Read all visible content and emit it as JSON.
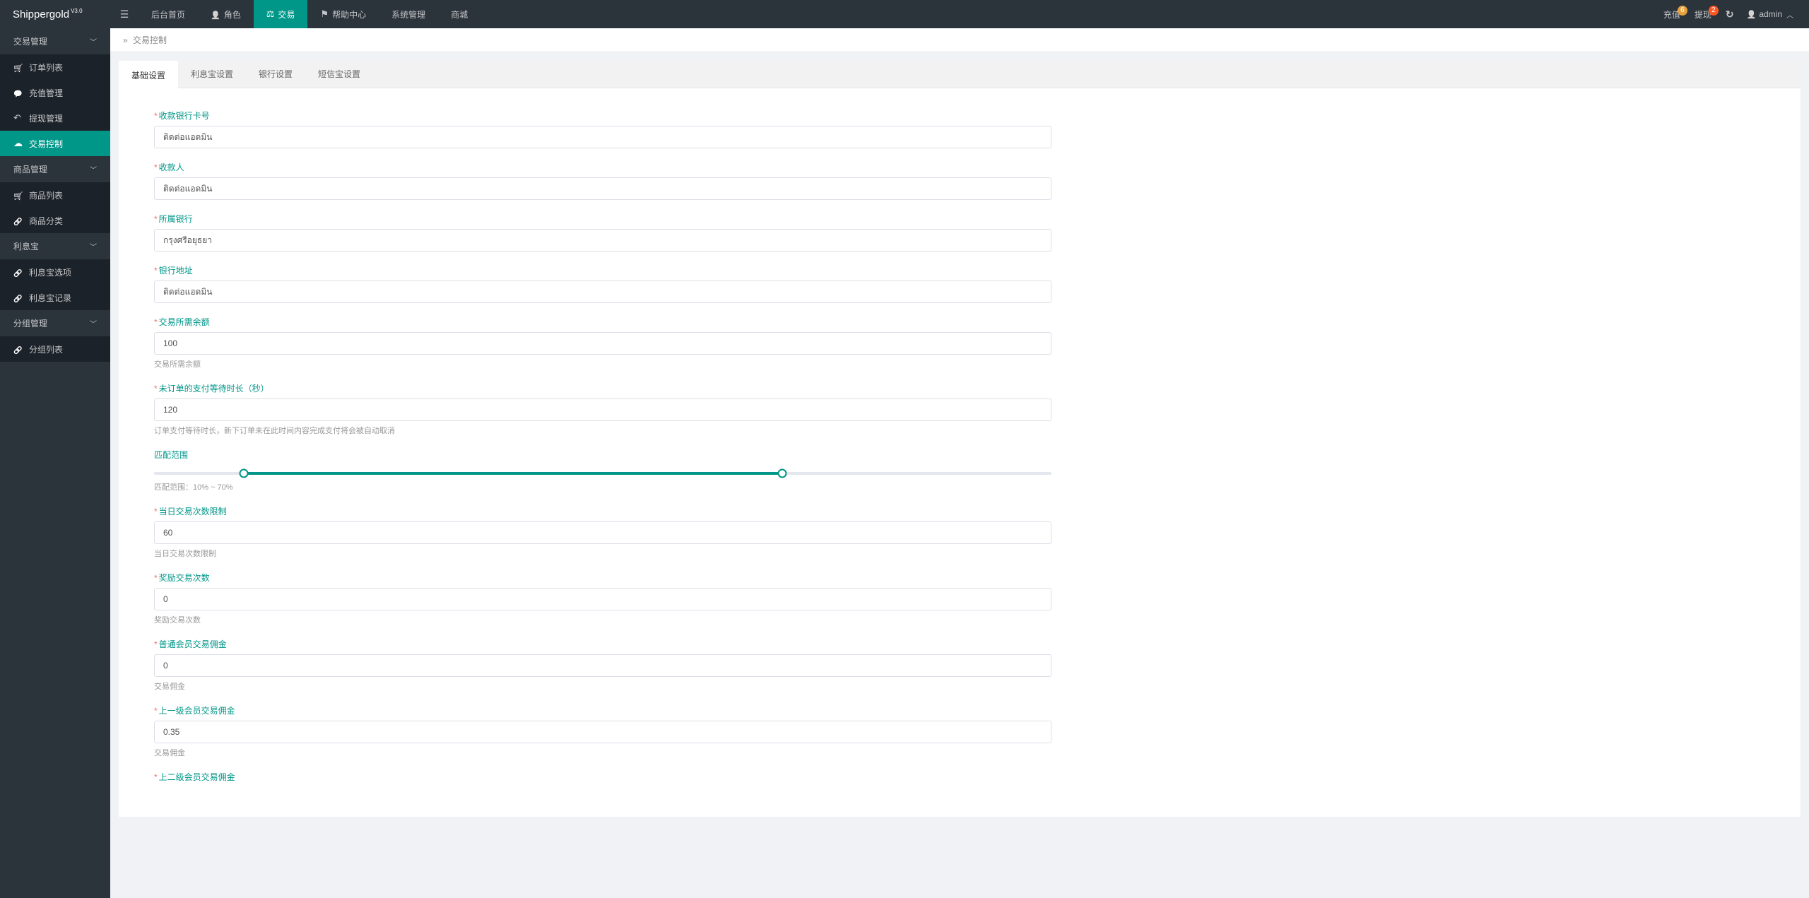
{
  "brand": {
    "name": "Shippergold",
    "version": "V3.0"
  },
  "topnav": {
    "items": [
      {
        "label": "后台首页",
        "icon": ""
      },
      {
        "label": "角色",
        "icon": "i-user"
      },
      {
        "label": "交易",
        "icon": "i-scale",
        "active": true
      },
      {
        "label": "帮助中心",
        "icon": "i-flag"
      },
      {
        "label": "系统管理",
        "icon": ""
      },
      {
        "label": "商城",
        "icon": ""
      }
    ],
    "right": {
      "recharge": {
        "label": "充值",
        "badge": "6"
      },
      "withdraw": {
        "label": "提现",
        "badge": "2"
      },
      "user": "admin"
    }
  },
  "sidebar": {
    "groups": [
      {
        "label": "交易管理",
        "items": [
          {
            "label": "订单列表",
            "icon": "i-cart"
          },
          {
            "label": "充值管理",
            "icon": "i-speech"
          },
          {
            "label": "提现管理",
            "icon": "i-back"
          },
          {
            "label": "交易控制",
            "icon": "i-cloud",
            "active": true
          }
        ]
      },
      {
        "label": "商品管理",
        "items": [
          {
            "label": "商品列表",
            "icon": "i-cart"
          },
          {
            "label": "商品分类",
            "icon": "i-link"
          }
        ]
      },
      {
        "label": "利息宝",
        "items": [
          {
            "label": "利息宝选项",
            "icon": "i-link"
          },
          {
            "label": "利息宝记录",
            "icon": "i-link"
          }
        ]
      },
      {
        "label": "分组管理",
        "items": [
          {
            "label": "分组列表",
            "icon": "i-link"
          }
        ]
      }
    ]
  },
  "breadcrumb": {
    "sep": "»",
    "current": "交易控制"
  },
  "tabs": [
    {
      "label": "基础设置",
      "active": true
    },
    {
      "label": "利息宝设置"
    },
    {
      "label": "银行设置"
    },
    {
      "label": "短信宝设置"
    }
  ],
  "form": {
    "bank_card": {
      "label": "收款银行卡号",
      "value": "ติดต่อแอดมิน"
    },
    "payee": {
      "label": "收款人",
      "value": "ติดต่อแอดมิน"
    },
    "bank_name": {
      "label": "所属银行",
      "value": "กรุงศรีอยุธยา"
    },
    "bank_addr": {
      "label": "银行地址",
      "value": "ติดต่อแอดมิน"
    },
    "balance": {
      "label": "交易所需余额",
      "value": "100",
      "help": "交易所需余额"
    },
    "pay_wait": {
      "label": "未订单的支付等待时长（秒）",
      "value": "120",
      "help": "订单支付等待时长，新下订单未在此时间内容完成支付将会被自动取消"
    },
    "range": {
      "label": "匹配范围",
      "help": "匹配范围：10% ~ 70%",
      "min_pct": 10,
      "max_pct": 70
    },
    "daily_limit": {
      "label": "当日交易次数限制",
      "value": "60",
      "help": "当日交易次数限制"
    },
    "reward_times": {
      "label": "奖励交易次数",
      "value": "0",
      "help": "奖励交易次数"
    },
    "normal_comm": {
      "label": "普通会员交易佣金",
      "value": "0",
      "help": "交易佣金"
    },
    "lvl1_comm": {
      "label": "上一级会员交易佣金",
      "value": "0.35",
      "help": "交易佣金"
    },
    "lvl2_comm": {
      "label": "上二级会员交易佣金"
    }
  }
}
